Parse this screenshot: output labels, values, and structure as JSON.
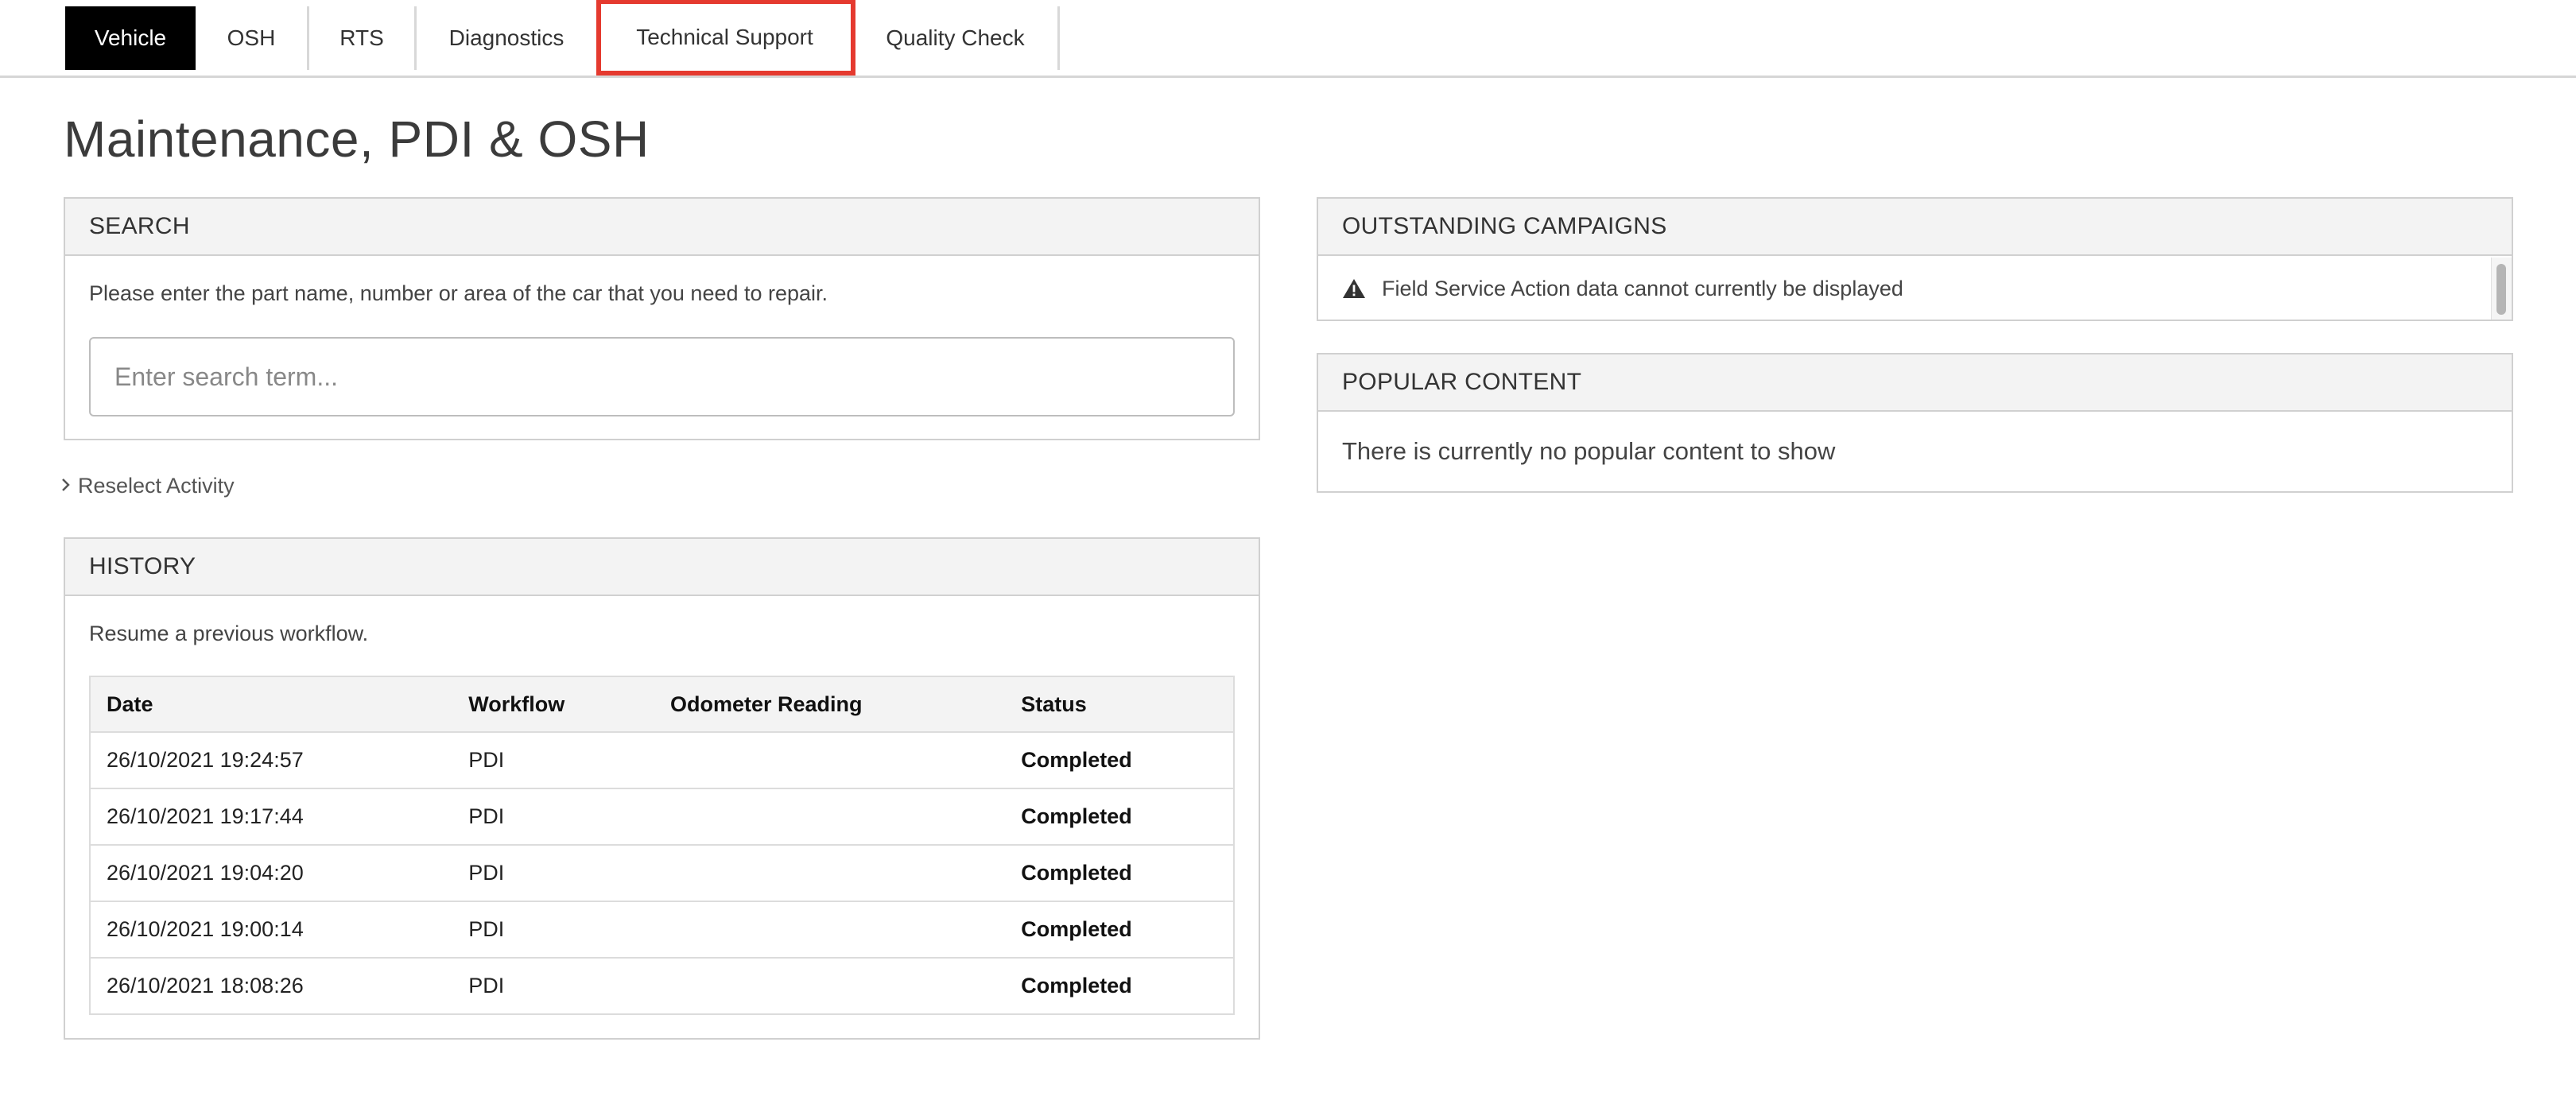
{
  "tabs": [
    {
      "label": "Vehicle",
      "active": true
    },
    {
      "label": "OSH",
      "active": false
    },
    {
      "label": "RTS",
      "active": false
    },
    {
      "label": "Diagnostics",
      "active": false
    },
    {
      "label": "Technical Support",
      "active": false,
      "highlighted": true
    },
    {
      "label": "Quality Check",
      "active": false
    }
  ],
  "page": {
    "title": "Maintenance, PDI & OSH"
  },
  "search": {
    "header": "SEARCH",
    "instructions": "Please enter the part name, number or area of the car that you need to repair.",
    "placeholder": "Enter search term...",
    "value": ""
  },
  "reselect": {
    "label": "Reselect Activity",
    "icon": "chevron-right-icon"
  },
  "history": {
    "header": "HISTORY",
    "description": "Resume a previous workflow.",
    "columns": [
      "Date",
      "Workflow",
      "Odometer Reading",
      "Status"
    ],
    "rows": [
      {
        "date": "26/10/2021 19:24:57",
        "workflow": "PDI",
        "odometer": "",
        "status": "Completed"
      },
      {
        "date": "26/10/2021 19:17:44",
        "workflow": "PDI",
        "odometer": "",
        "status": "Completed"
      },
      {
        "date": "26/10/2021 19:04:20",
        "workflow": "PDI",
        "odometer": "",
        "status": "Completed"
      },
      {
        "date": "26/10/2021 19:00:14",
        "workflow": "PDI",
        "odometer": "",
        "status": "Completed"
      },
      {
        "date": "26/10/2021 18:08:26",
        "workflow": "PDI",
        "odometer": "",
        "status": "Completed"
      }
    ]
  },
  "campaigns": {
    "header": "OUTSTANDING CAMPAIGNS",
    "message": "Field Service Action data cannot currently be displayed",
    "icon": "warning-icon"
  },
  "popular": {
    "header": "POPULAR CONTENT",
    "empty_message": "There is currently no popular content to show"
  },
  "colors": {
    "active_tab_bg": "#000000",
    "highlight_outline": "#e53a2f",
    "panel_header_bg": "#f3f3f3",
    "border": "#d0d0d0"
  }
}
